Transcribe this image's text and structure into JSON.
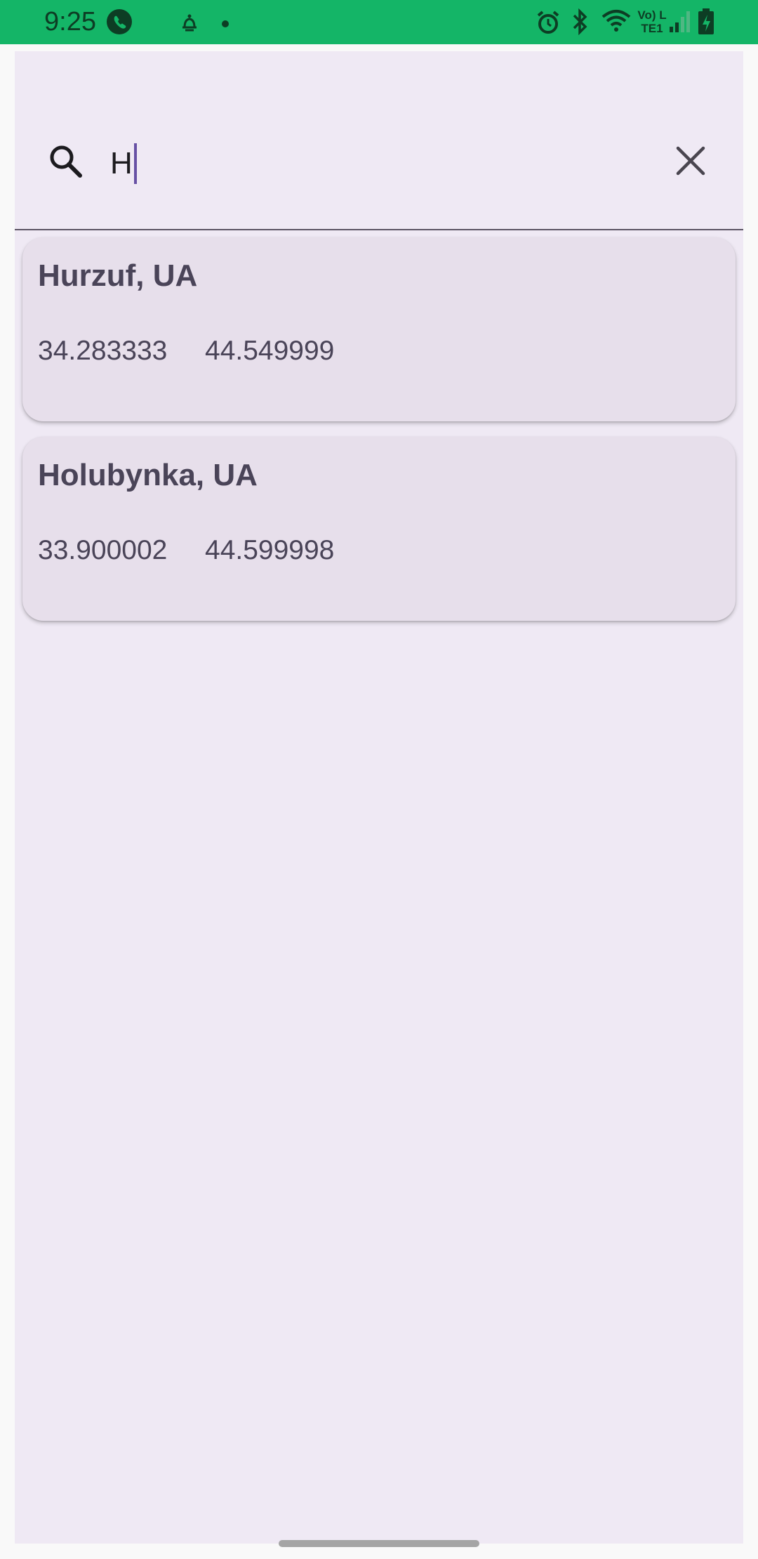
{
  "status_bar": {
    "time": "9:25",
    "network_label": "Vo) LTE1",
    "icons": [
      "phone-call-icon",
      "notification-bell-icon",
      "dot-icon",
      "alarm-icon",
      "bluetooth-icon",
      "wifi-icon",
      "signal-icon",
      "battery-charging-icon"
    ],
    "background_color": "#14b567"
  },
  "search": {
    "query": "H",
    "icon": "search-icon",
    "clear_icon": "close-icon"
  },
  "results": [
    {
      "name": "Hurzuf, UA",
      "lon": "34.283333",
      "lat": "44.549999"
    },
    {
      "name": "Holubynka, UA",
      "lon": "33.900002",
      "lat": "44.599998"
    }
  ],
  "colors": {
    "accent": "#6750a4",
    "surface": "#efe9f4",
    "card": "#e7dfeb",
    "text": "#4a4458"
  }
}
